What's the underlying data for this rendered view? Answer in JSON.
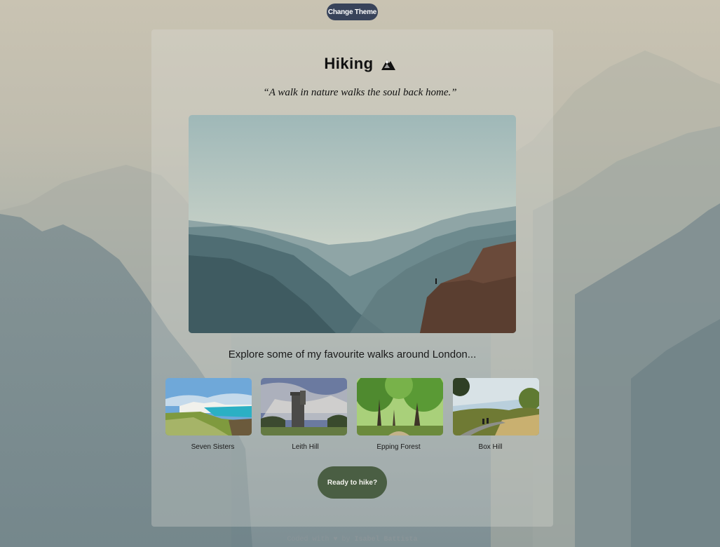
{
  "theme_button": {
    "label": "Change Theme"
  },
  "header": {
    "title": "Hiking",
    "icon": "mountain-icon"
  },
  "quote": "“A walk in nature walks the soul back home.”",
  "explore_text": "Explore some of my favourite walks around London...",
  "walks": [
    {
      "label": "Seven Sisters"
    },
    {
      "label": "Leith Hill"
    },
    {
      "label": "Epping Forest"
    },
    {
      "label": "Box Hill"
    }
  ],
  "cta": {
    "label": "Ready to hike?"
  },
  "footer": {
    "prefix": "Coded with ",
    "heart": "♥",
    "by": " by ",
    "author": "Isabel Battista"
  },
  "colors": {
    "theme_button": "#38435a",
    "cta_button": "#4a5e43",
    "card_overlay": "rgba(222,222,214,0.32)"
  }
}
